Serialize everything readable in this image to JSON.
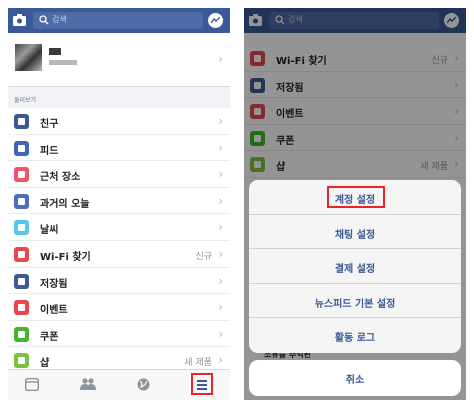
{
  "left_screen": {
    "search": {
      "placeholder": "검색"
    },
    "profile": {
      "name": "",
      "subtitle": ""
    },
    "shortcuts_header": "둘러보기",
    "items": [
      {
        "label": "친구",
        "badge": "",
        "icon": "friends-icon",
        "color": "#3b5998"
      },
      {
        "label": "피드",
        "badge": "",
        "icon": "feed-icon",
        "color": "#4267b2"
      },
      {
        "label": "근처 장소",
        "badge": "",
        "icon": "location-pin-icon",
        "color": "#f35369"
      },
      {
        "label": "과거의 오늘",
        "badge": "",
        "icon": "clock-icon",
        "color": "#4b6fbd"
      },
      {
        "label": "날씨",
        "badge": "",
        "icon": "weather-icon",
        "color": "#54c7ec"
      },
      {
        "label": "Wi-Fi 찾기",
        "badge": "신규",
        "icon": "wifi-icon",
        "color": "#e9474c"
      },
      {
        "label": "저장됨",
        "badge": "",
        "icon": "bookmark-icon",
        "color": "#3c5a99"
      },
      {
        "label": "이벤트",
        "badge": "",
        "icon": "calendar-icon",
        "color": "#e9474c"
      },
      {
        "label": "쿠폰",
        "badge": "",
        "icon": "coupon-icon",
        "color": "#42b72a"
      },
      {
        "label": "샵",
        "badge": "새 제품",
        "icon": "shop-icon",
        "color": "#7cc242"
      }
    ],
    "bottom_tabs": [
      "news-feed-tab",
      "friends-tab",
      "globe-tab",
      "menu-tab"
    ]
  },
  "right_screen": {
    "search": {
      "placeholder": "검색"
    },
    "items": [
      {
        "label": "Wi-Fi 찾기",
        "badge": "신규",
        "icon": "wifi-icon",
        "color": "#e9474c"
      },
      {
        "label": "저장됨",
        "badge": "",
        "icon": "bookmark-icon",
        "color": "#3c5a99"
      },
      {
        "label": "이벤트",
        "badge": "",
        "icon": "calendar-icon",
        "color": "#e9474c"
      },
      {
        "label": "쿠폰",
        "badge": "",
        "icon": "coupon-icon",
        "color": "#42b72a"
      },
      {
        "label": "샵",
        "badge": "새 제품",
        "icon": "shop-icon",
        "color": "#7cc242"
      }
    ],
    "action_sheet": {
      "options": [
        "계정 설정",
        "채팅 설정",
        "결제 설정",
        "뉴스피드 기본 설정",
        "활동 로그"
      ],
      "cancel": "취소"
    },
    "peek_text": "소유를 추억된"
  },
  "colors": {
    "brand": "#3b5998",
    "highlight": "#e8242c"
  }
}
